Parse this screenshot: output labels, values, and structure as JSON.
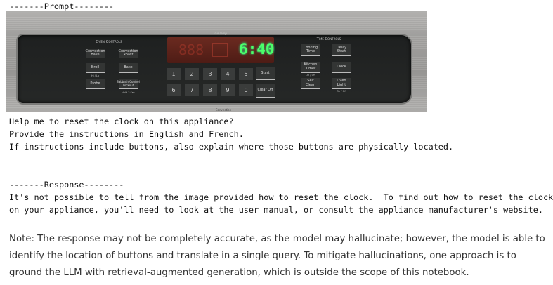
{
  "prompt_header": "-------Prompt--------",
  "photo": {
    "brand_label": "TrueTemp",
    "bottom_label": "Convection",
    "display_time": "6:40",
    "display_dim": "888",
    "oven_controls": {
      "title": "Oven Controls",
      "buttons": [
        "Convection Bake",
        "Convection Roast",
        "Broil",
        "Bake",
        "Probe",
        "Sabbath/Control Lockout"
      ],
      "broil_sub": "Hi / Lo",
      "lockout_sub": "Hold 3 Sec"
    },
    "keypad": [
      "1",
      "2",
      "3",
      "4",
      "5",
      "6",
      "7",
      "8",
      "9",
      "0"
    ],
    "start": "Start",
    "clear_off": "Clear Off",
    "time_controls": {
      "title": "Time Controls",
      "buttons": [
        "Cooking Time",
        "Delay Start",
        "Kitchen Timer",
        "Clock",
        "Self Clean",
        "Oven Light"
      ],
      "on_off": "On / Off"
    },
    "colors": {
      "display_bg": "#5a2018",
      "display_time": "#4cff6a"
    }
  },
  "prompt_lines": [
    "Help me to reset the clock on this appliance?",
    "Provide the instructions in English and French.",
    "If instructions include buttons, also explain where those buttons are physically located."
  ],
  "response_header": "-------Response--------",
  "response_text": "It's not possible to tell from the image provided how to reset the clock.  To find out how to reset the clock on your appliance, you'll need to look at the user manual, or consult the appliance manufacturer's website.",
  "note": "Note: The response may not be completely accurate, as the model may hallucinate; however, the model is able to identify the location of buttons and translate in a single query. To mitigate hallucinations, one approach is to ground the LLM with retrieval-augmented generation, which is outside the scope of this notebook."
}
